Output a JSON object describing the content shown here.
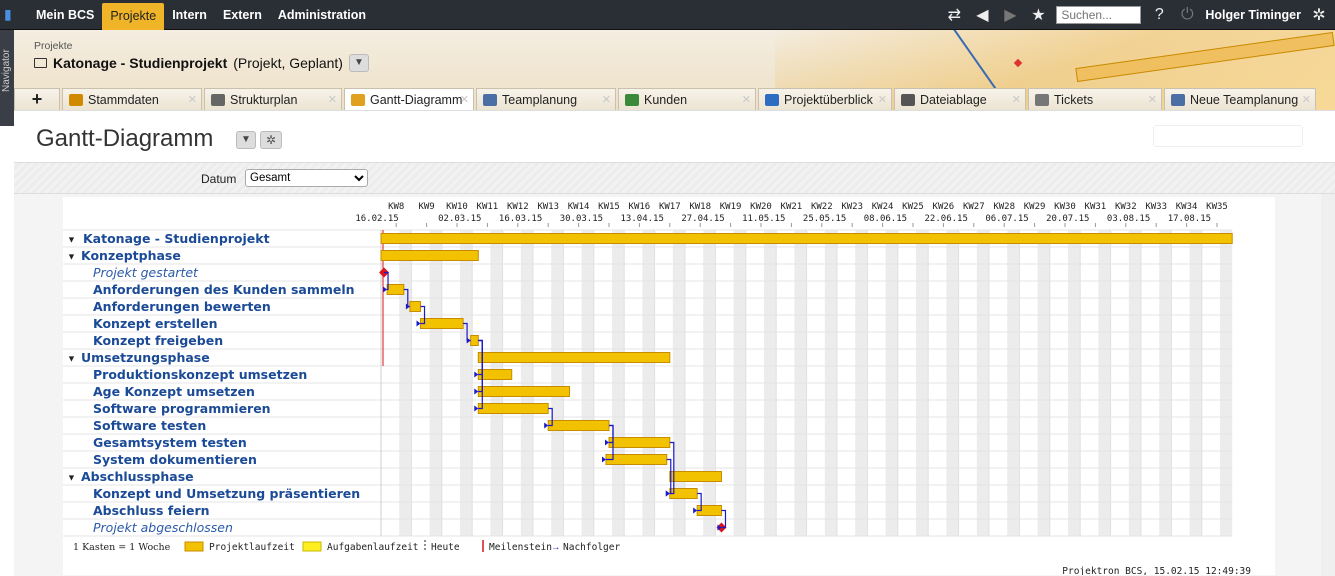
{
  "topbar": {
    "menu": [
      "Mein BCS",
      "Projekte",
      "Intern",
      "Extern",
      "Administration"
    ],
    "active_index": 1,
    "search_placeholder": "Suchen...",
    "help": "?",
    "user": "Holger Timinger"
  },
  "navigator_label": "Navigator",
  "header": {
    "breadcrumb": "Projekte",
    "project_name": "Katonage - Studienprojekt",
    "project_meta": "(Projekt, Geplant)"
  },
  "tabs": [
    {
      "label": "Stammdaten",
      "icon": "folder-icon",
      "color": "#d08a00"
    },
    {
      "label": "Strukturplan",
      "icon": "tree-icon",
      "color": "#666"
    },
    {
      "label": "Gantt-Diagramm",
      "icon": "gantt-icon",
      "color": "#e0a020",
      "active": true
    },
    {
      "label": "Teamplanung",
      "icon": "people-icon",
      "color": "#4a6fa5"
    },
    {
      "label": "Kunden",
      "icon": "table-icon",
      "color": "#3a8a3a"
    },
    {
      "label": "Projektüberblick",
      "icon": "info-icon",
      "color": "#2d6cc0"
    },
    {
      "label": "Dateiablage",
      "icon": "paperclip-icon",
      "color": "#555"
    },
    {
      "label": "Tickets",
      "icon": "tools-icon",
      "color": "#777"
    },
    {
      "label": "Neue Teamplanung",
      "icon": "people-icon",
      "color": "#4a6fa5"
    }
  ],
  "page": {
    "title": "Gantt-Diagramm"
  },
  "filter": {
    "label": "Datum",
    "value": "Gesamt"
  },
  "chart_data": {
    "type": "gantt",
    "weeks": [
      "KW8",
      "KW9",
      "KW10",
      "KW11",
      "KW12",
      "KW13",
      "KW14",
      "KW15",
      "KW16",
      "KW17",
      "KW18",
      "KW19",
      "KW20",
      "KW21",
      "KW22",
      "KW23",
      "KW24",
      "KW25",
      "KW26",
      "KW27",
      "KW28",
      "KW29",
      "KW30",
      "KW31",
      "KW32",
      "KW33",
      "KW34",
      "KW35"
    ],
    "dates": [
      "16.02.15",
      "02.03.15",
      "16.03.15",
      "30.03.15",
      "13.04.15",
      "27.04.15",
      "11.05.15",
      "25.05.15",
      "08.06.15",
      "22.06.15",
      "06.07.15",
      "20.07.15",
      "03.08.15",
      "17.08.15"
    ],
    "date_week_index": [
      0,
      2,
      4,
      6,
      8,
      10,
      12,
      14,
      16,
      18,
      20,
      22,
      24,
      26
    ],
    "rows": [
      {
        "label": "Katonage - Studienprojekt",
        "type": "group",
        "level": 0,
        "start": 0,
        "end": 28,
        "color": "project"
      },
      {
        "label": "Konzeptphase",
        "type": "group",
        "level": 1,
        "start": 0,
        "end": 3.2,
        "color": "project"
      },
      {
        "label": "Projekt gestartet",
        "type": "milestone",
        "level": 2,
        "at": 0.1
      },
      {
        "label": "Anforderungen des Kunden sammeln",
        "type": "task",
        "level": 2,
        "start": 0.2,
        "end": 0.75
      },
      {
        "label": "Anforderungen bewerten",
        "type": "task",
        "level": 2,
        "start": 0.95,
        "end": 1.3
      },
      {
        "label": "Konzept erstellen",
        "type": "task",
        "level": 2,
        "start": 1.3,
        "end": 2.7
      },
      {
        "label": "Konzept freigeben",
        "type": "task",
        "level": 2,
        "start": 2.95,
        "end": 3.2
      },
      {
        "label": "Umsetzungsphase",
        "type": "group",
        "level": 1,
        "start": 3.2,
        "end": 9.5,
        "color": "project"
      },
      {
        "label": "Produktionskonzept umsetzen",
        "type": "task",
        "level": 2,
        "start": 3.2,
        "end": 4.3
      },
      {
        "label": "Age Konzept umsetzen",
        "type": "task",
        "level": 2,
        "start": 3.2,
        "end": 6.2
      },
      {
        "label": "Software programmieren",
        "type": "task",
        "level": 2,
        "start": 3.2,
        "end": 5.5
      },
      {
        "label": "Software testen",
        "type": "task",
        "level": 2,
        "start": 5.5,
        "end": 7.5
      },
      {
        "label": "Gesamtsystem testen",
        "type": "task",
        "level": 2,
        "start": 7.5,
        "end": 9.5
      },
      {
        "label": "System dokumentieren",
        "type": "task",
        "level": 2,
        "start": 7.4,
        "end": 9.4
      },
      {
        "label": "Abschlussphase",
        "type": "group",
        "level": 1,
        "start": 9.5,
        "end": 11.2,
        "color": "project"
      },
      {
        "label": "Konzept und Umsetzung präsentieren",
        "type": "task",
        "level": 2,
        "start": 9.5,
        "end": 10.4
      },
      {
        "label": "Abschluss feiern",
        "type": "task",
        "level": 2,
        "start": 10.4,
        "end": 11.2
      },
      {
        "label": "Projekt abgeschlossen",
        "type": "milestone",
        "level": 2,
        "at": 11.2
      }
    ],
    "colors": {
      "project": "#f2c200",
      "task": "#f2c200",
      "border": "#c78c00",
      "milestone": "#d9141c",
      "link": "#1a1ac8",
      "grid": "#e0e0e0"
    }
  },
  "legend": {
    "scale": "1 Kasten = 1 Woche",
    "projektlaufzeit": "Projektlaufzeit",
    "aufgabenlaufzeit": "Aufgabenlaufzeit",
    "heute": "Heute",
    "meilenstein": "Meilenstein",
    "nachfolger": "Nachfolger"
  },
  "footer": "Projektron BCS, 15.02.15  12:49:39"
}
